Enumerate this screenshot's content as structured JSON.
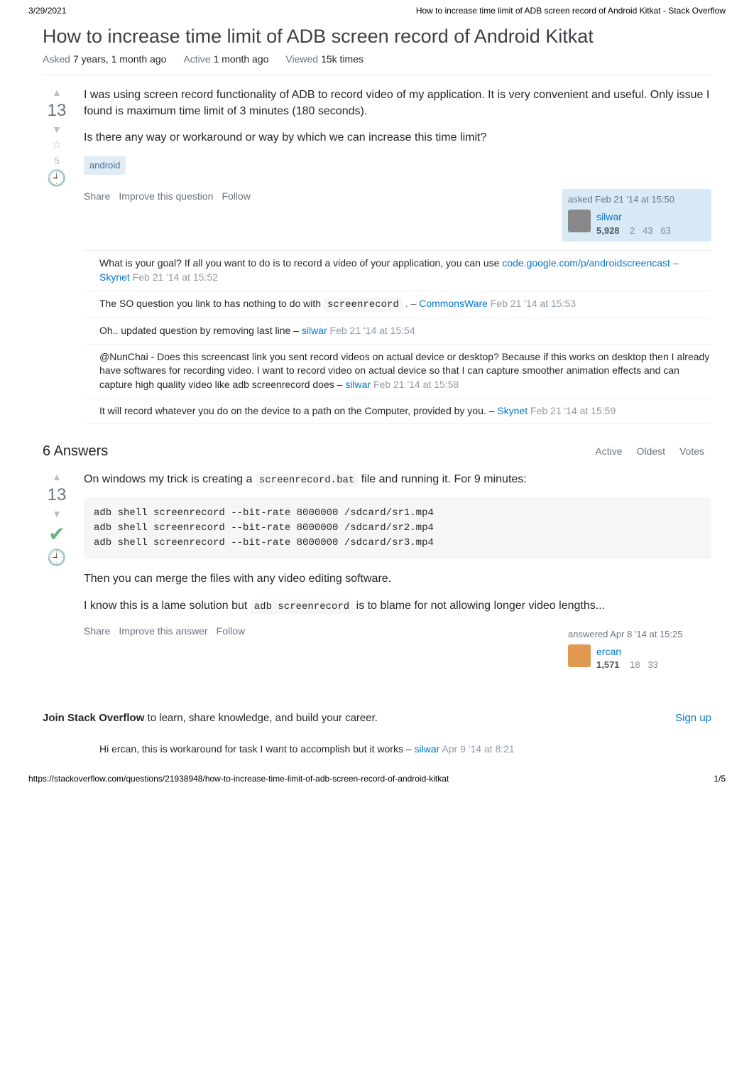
{
  "print": {
    "date": "3/29/2021",
    "title": "How to increase time limit of ADB screen record of Android Kitkat - Stack Overflow",
    "url": "https://stackoverflow.com/questions/21938948/how-to-increase-time-limit-of-adb-screen-record-of-android-kitkat",
    "page": "1/5"
  },
  "question": {
    "title": "How to increase time limit of ADB screen record of Android Kitkat",
    "meta": {
      "asked_label": "Asked",
      "asked_value": "7 years, 1 month ago",
      "active_label": "Active",
      "active_value": "1 month ago",
      "viewed_label": "Viewed",
      "viewed_value": "15k times"
    },
    "vote_count": "13",
    "fav_count": "5",
    "body_p1": "I was using screen record functionality of ADB to record video of my application. It is very convenient and useful. Only issue I found is maximum time limit of 3 minutes (180 seconds).",
    "body_p2": "Is there any way or workaround or way by which we can increase this time limit?",
    "tag": "android",
    "actions": {
      "share": "Share",
      "improve": "Improve this question",
      "follow": "Follow"
    },
    "user": {
      "asked_line": "asked Feb 21 '14 at 15:50",
      "name": "silwar",
      "rep": "5,928",
      "gold": "2",
      "silver": "43",
      "bronze": "63"
    }
  },
  "comments": [
    {
      "text_a": "What is your goal? If all you want to do is to record a video of your application, you can use ",
      "link": "code.google.com/p/androidscreencast",
      "sep": " – ",
      "user": "Skynet",
      "date": " Feb 21 '14 at 15:52"
    },
    {
      "text_a": "The SO question you link to has nothing to do with ",
      "code": "screenrecord",
      "text_b": " . – ",
      "user": "CommonsWare",
      "date": " Feb 21 '14 at 15:53"
    },
    {
      "text_a": "Oh.. updated question by removing last line –  ",
      "user": "silwar",
      "date": "  Feb 21 '14 at 15:54"
    },
    {
      "text_a": "@NunChai - Does this screencast link you sent record videos on actual device or desktop? Because if this works on desktop then I already have softwares for recording video. I want to record video on actual device so that I can capture smoother animation effects and can capture high quality video like adb screenrecord does –  ",
      "user": "silwar",
      "date": "  Feb 21 '14 at 15:58"
    },
    {
      "text_a": "It will record whatever you do on the device to a path on the Computer, provided by you. – ",
      "user": "Skynet",
      "date": " Feb 21 '14 at 15:59"
    }
  ],
  "answers_header": {
    "count_text": "6 Answers",
    "sort": {
      "active": "Active",
      "oldest": "Oldest",
      "votes": "Votes"
    }
  },
  "answer1": {
    "vote_count": "13",
    "p1a": "On windows my trick is creating a ",
    "p1_code": "screenrecord.bat",
    "p1b": " file and running it. For 9 minutes:",
    "codeblock": "adb shell screenrecord --bit-rate 8000000 /sdcard/sr1.mp4\nadb shell screenrecord --bit-rate 8000000 /sdcard/sr2.mp4\nadb shell screenrecord --bit-rate 8000000 /sdcard/sr3.mp4",
    "p2": "Then you can merge the files with any video editing software.",
    "p3a": "I know this is a lame solution but ",
    "p3_code": "adb screenrecord",
    "p3b": " is to blame for not allowing longer video lengths...",
    "actions": {
      "share": "Share",
      "improve": "Improve this answer",
      "follow": "Follow"
    },
    "user": {
      "answered_line": "answered Apr 8 '14 at 15:25",
      "name": "ercan",
      "rep": "1,571",
      "silver": "18",
      "bronze": "33"
    },
    "comment": {
      "text_a": "Hi ercan, this is workaround for task I want to accomplish but it works  –  ",
      "user": "silwar",
      "date": "  Apr 9 '14 at 8:21"
    }
  },
  "banner": {
    "bold": "Join Stack Overflow",
    "rest": " to learn, share knowledge, and build your career.",
    "signup": "Sign up"
  }
}
